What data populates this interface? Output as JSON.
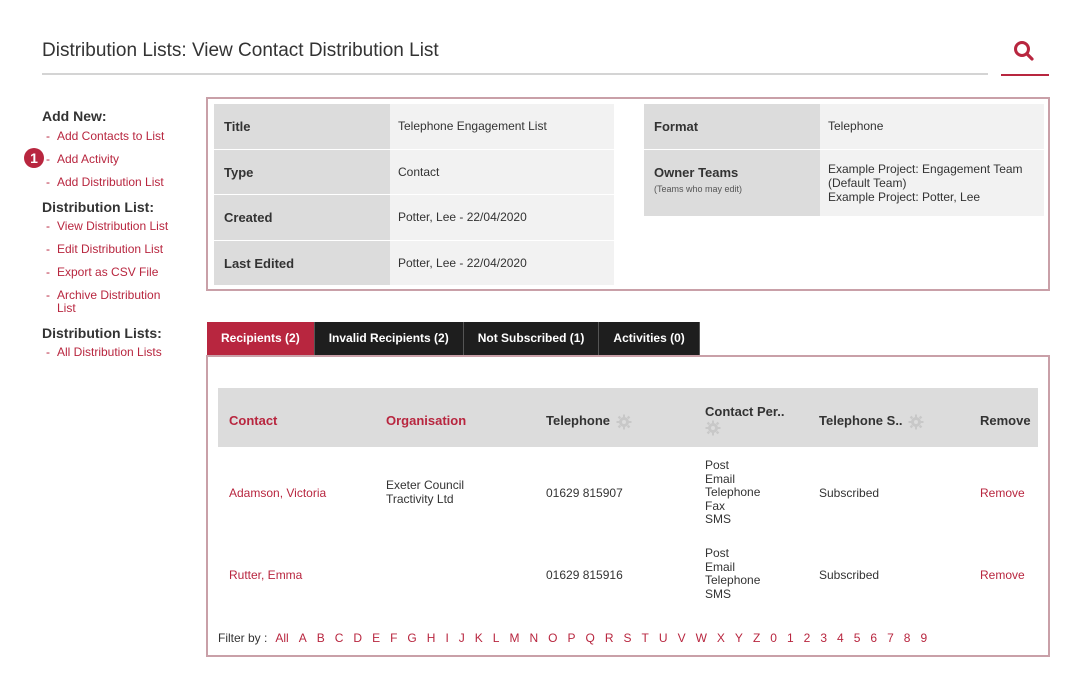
{
  "header": {
    "title": "Distribution Lists: View Contact Distribution List",
    "search_icon": "search-icon",
    "accent": "#b8263f"
  },
  "sidebar": {
    "badge": "1",
    "sections": [
      {
        "heading": "Add New:",
        "links": [
          "Add Contacts to List",
          "Add Activity",
          "Add Distribution List"
        ]
      },
      {
        "heading": "Distribution List:",
        "links": [
          "View Distribution List",
          "Edit Distribution List",
          "Export as CSV File",
          "Archive Distribution List"
        ]
      },
      {
        "heading": "Distribution Lists:",
        "links": [
          "All Distribution Lists"
        ]
      }
    ],
    "dash": "-"
  },
  "details": {
    "left": [
      {
        "label": "Title",
        "value": "Telephone Engagement List"
      },
      {
        "label": "Type",
        "value": "Contact"
      },
      {
        "label": "Created",
        "value": "Potter, Lee - 22/04/2020"
      },
      {
        "label": "Last Edited",
        "value": "Potter, Lee - 22/04/2020"
      }
    ],
    "right": {
      "format_label": "Format",
      "format_value": "Telephone",
      "owner_label": "Owner Teams",
      "owner_sub": "(Teams who may edit)",
      "owner_values": [
        "Example Project: Engagement Team",
        "(Default Team)",
        "Example Project: Potter, Lee"
      ]
    }
  },
  "tabs": [
    "Recipients (2)",
    "Invalid Recipients (2)",
    "Not Subscribed (1)",
    "Activities (0)"
  ],
  "table": {
    "headers": {
      "contact": "Contact",
      "organisation": "Organisation",
      "telephone": "Telephone",
      "contact_pref": "Contact Per..",
      "telephone_s": "Telephone S..",
      "remove": "Remove"
    },
    "rows": [
      {
        "contact": "Adamson, Victoria",
        "organisation": [
          "Exeter Council",
          "Tractivity Ltd"
        ],
        "telephone": "01629 815907",
        "prefs": [
          "Post",
          "Email",
          "Telephone",
          "Fax",
          "SMS"
        ],
        "status": "Subscribed",
        "remove": "Remove"
      },
      {
        "contact": "Rutter, Emma",
        "organisation": [],
        "telephone": "01629 815916",
        "prefs": [
          "Post",
          "Email",
          "Telephone",
          "SMS"
        ],
        "status": "Subscribed",
        "remove": "Remove"
      }
    ]
  },
  "filter": {
    "label": "Filter by :",
    "letters": [
      "All",
      "A",
      "B",
      "C",
      "D",
      "E",
      "F",
      "G",
      "H",
      "I",
      "J",
      "K",
      "L",
      "M",
      "N",
      "O",
      "P",
      "Q",
      "R",
      "S",
      "T",
      "U",
      "V",
      "W",
      "X",
      "Y",
      "Z",
      "0",
      "1",
      "2",
      "3",
      "4",
      "5",
      "6",
      "7",
      "8",
      "9"
    ]
  }
}
